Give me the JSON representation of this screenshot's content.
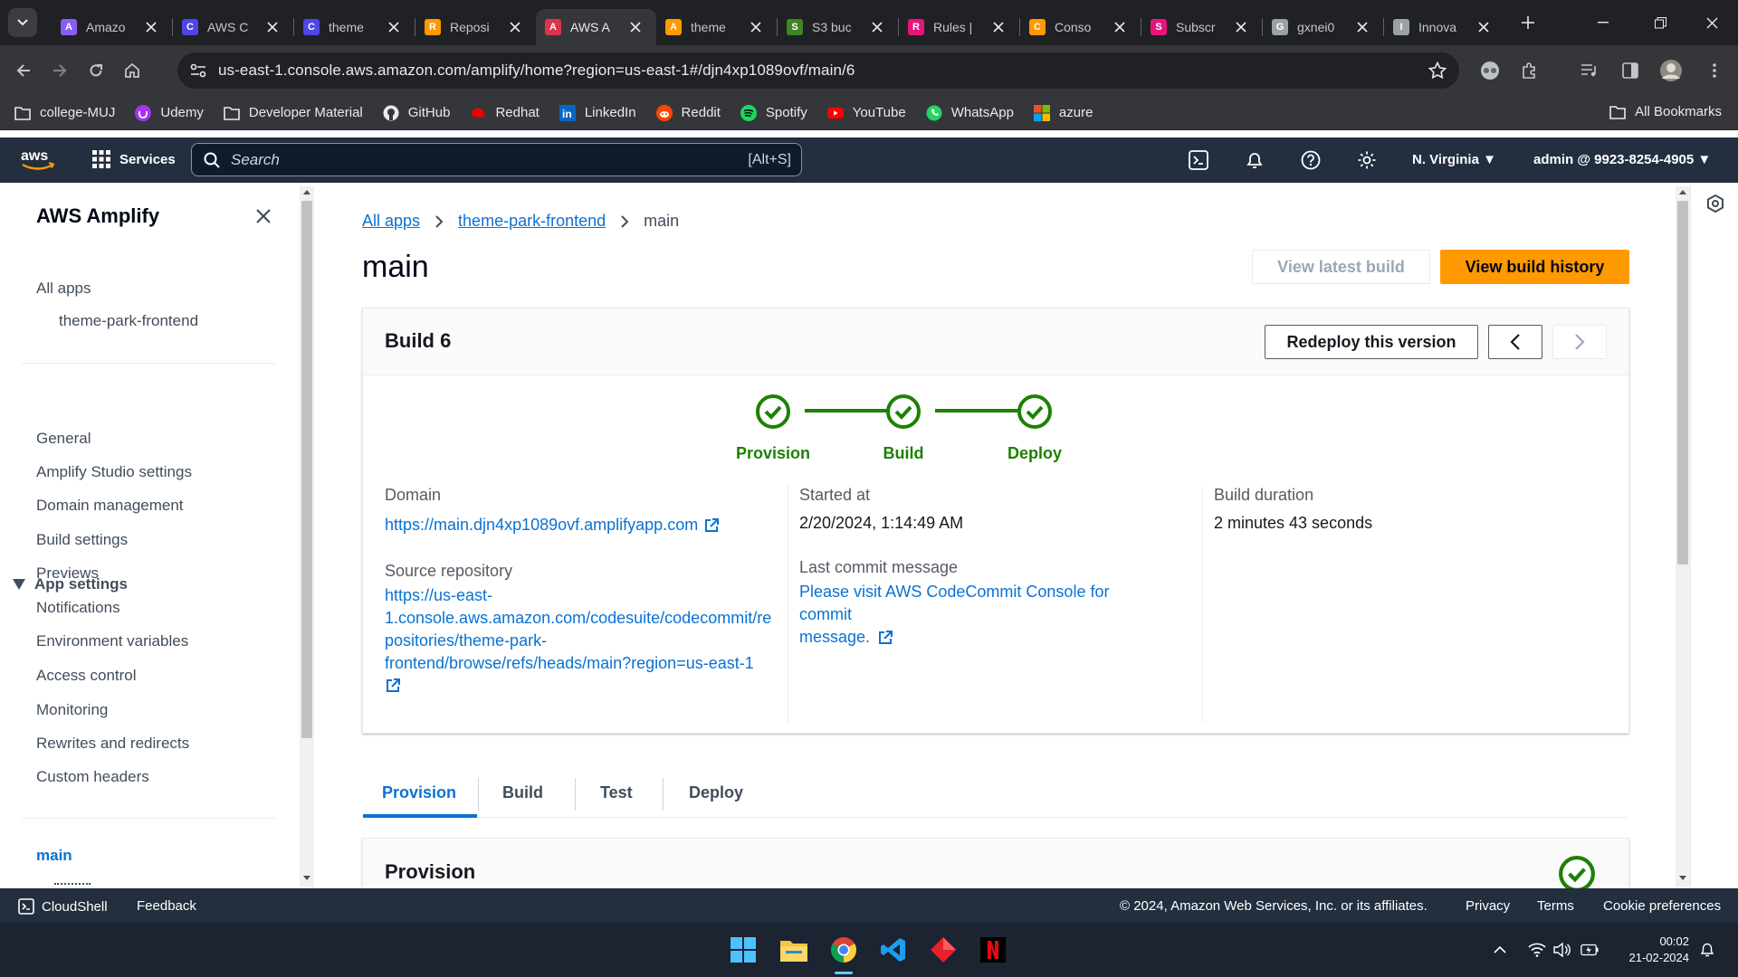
{
  "browser": {
    "tabs": [
      {
        "title": "Amazo",
        "fav_color": "#8a5cf6",
        "fav_glyph": "A"
      },
      {
        "title": "AWS C",
        "fav_color": "#4f46e5",
        "fav_glyph": "C"
      },
      {
        "title": "theme",
        "fav_color": "#4f46e5",
        "fav_glyph": "C"
      },
      {
        "title": "Reposi",
        "fav_color": "#ff9900",
        "fav_glyph": "R"
      },
      {
        "title": "AWS A",
        "fav_color": "#dd344c",
        "fav_glyph": "A"
      },
      {
        "title": "theme",
        "fav_color": "#ff9900",
        "fav_glyph": "A"
      },
      {
        "title": "S3 buc",
        "fav_color": "#3f8624",
        "fav_glyph": "S"
      },
      {
        "title": "Rules |",
        "fav_color": "#e7157b",
        "fav_glyph": "R"
      },
      {
        "title": "Conso",
        "fav_color": "#ff9900",
        "fav_glyph": "C"
      },
      {
        "title": "Subscr",
        "fav_color": "#e7157b",
        "fav_glyph": "S"
      },
      {
        "title": "gxnei0",
        "fav_color": "#9aa0a6",
        "fav_glyph": "G"
      },
      {
        "title": "Innova",
        "fav_color": "#9aa0a6",
        "fav_glyph": "I"
      }
    ],
    "url": "us-east-1.console.aws.amazon.com/amplify/home?region=us-east-1#/djn4xp1089ovf/main/6",
    "bookmarks": [
      {
        "label": "college-MUJ",
        "icon": "folder-icon"
      },
      {
        "label": "Udemy",
        "icon": "udemy-icon"
      },
      {
        "label": "Developer Material",
        "icon": "folder-icon"
      },
      {
        "label": "GitHub",
        "icon": "github-icon"
      },
      {
        "label": "Redhat",
        "icon": "redhat-icon"
      },
      {
        "label": "LinkedIn",
        "icon": "linkedin-icon"
      },
      {
        "label": "Reddit",
        "icon": "reddit-icon"
      },
      {
        "label": "Spotify",
        "icon": "spotify-icon"
      },
      {
        "label": "YouTube",
        "icon": "youtube-icon"
      },
      {
        "label": "WhatsApp",
        "icon": "whatsapp-icon"
      },
      {
        "label": "azure",
        "icon": "azure-icon"
      }
    ],
    "all_bookmarks": "All Bookmarks"
  },
  "aws_header": {
    "services": "Services",
    "search_placeholder": "Search",
    "search_hint": "[Alt+S]",
    "region": "N. Virginia",
    "account": "admin @ 9923-8254-4905"
  },
  "sidebar": {
    "title": "AWS Amplify",
    "all_apps": "All apps",
    "app_name": "theme-park-frontend",
    "group": "App settings",
    "items": [
      "General",
      "Amplify Studio settings",
      "Domain management",
      "Build settings",
      "Previews",
      "Notifications",
      "Environment variables",
      "Access control",
      "Monitoring",
      "Rewrites and redirects",
      "Custom headers"
    ],
    "active_branch": "main"
  },
  "main": {
    "breadcrumbs": {
      "root": "All apps",
      "app": "theme-park-frontend",
      "current": "main"
    },
    "title": "main",
    "btn_view_latest": "View latest build",
    "btn_view_history": "View build history",
    "build": {
      "title": "Build 6",
      "redeploy": "Redeploy this version",
      "steps": [
        "Provision",
        "Build",
        "Deploy"
      ],
      "domain_label": "Domain",
      "domain_value": "https://main.djn4xp1089ovf.amplifyapp.com",
      "repo_label": "Source repository",
      "repo_lines": [
        "https://us-east-",
        "1.console.aws.amazon.com/codesuite/codecommit/re",
        "positories/theme-park-",
        "frontend/browse/refs/heads/main?region=us-east-1"
      ],
      "started_label": "Started at",
      "started_value": "2/20/2024, 1:14:49 AM",
      "commit_label": "Last commit message",
      "commit_lines": [
        "Please visit AWS CodeCommit Console for commit",
        "message."
      ],
      "duration_label": "Build duration",
      "duration_value": "2 minutes 43 seconds"
    },
    "tabs": [
      "Provision",
      "Build",
      "Test",
      "Deploy"
    ],
    "section_title": "Provision"
  },
  "footer": {
    "cloudshell": "CloudShell",
    "feedback": "Feedback",
    "copyright": "© 2024, Amazon Web Services, Inc. or its affiliates.",
    "privacy": "Privacy",
    "terms": "Terms",
    "cookie": "Cookie preferences"
  },
  "taskbar": {
    "time": "00:02",
    "date": "21-02-2024"
  },
  "colors": {
    "aws_nav": "#232f3e",
    "primary_orange": "#ff9900",
    "link_blue": "#0972d3",
    "success_green": "#1d8102"
  }
}
